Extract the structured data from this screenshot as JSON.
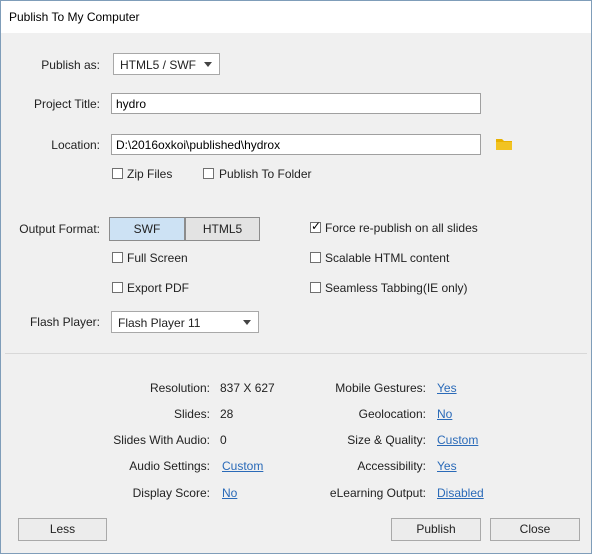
{
  "window": {
    "title": "Publish To My Computer"
  },
  "publish_as": {
    "label": "Publish as:",
    "value": "HTML5 / SWF"
  },
  "project_title": {
    "label": "Project Title:",
    "value": "hydro"
  },
  "location": {
    "label": "Location:",
    "value": "D:\\2016oxkoi\\published\\hydrox",
    "icon": "folder-icon",
    "icon_color": "#e8b100"
  },
  "zip_files": {
    "label": "Zip Files",
    "checked": false
  },
  "publish_to_folder": {
    "label": "Publish To Folder",
    "checked": false
  },
  "output_format": {
    "label": "Output Format:",
    "options": [
      "SWF",
      "HTML5"
    ],
    "selected": "SWF"
  },
  "force_republish": {
    "label": "Force re-publish on all slides",
    "checked": true
  },
  "full_screen": {
    "label": "Full Screen",
    "checked": false
  },
  "scalable_html": {
    "label": "Scalable HTML content",
    "checked": false
  },
  "export_pdf": {
    "label": "Export PDF",
    "checked": false
  },
  "seamless_tabbing": {
    "label": "Seamless Tabbing(IE only)",
    "checked": false
  },
  "flash_player": {
    "label": "Flash Player:",
    "value": "Flash Player 11"
  },
  "info": {
    "resolution": {
      "label": "Resolution:",
      "value": "837 X 627"
    },
    "slides": {
      "label": "Slides:",
      "value": "28"
    },
    "slides_with_audio": {
      "label": "Slides With Audio:",
      "value": "0"
    },
    "audio_settings": {
      "label": "Audio Settings:",
      "value": "Custom"
    },
    "display_score": {
      "label": "Display Score:",
      "value": "No"
    },
    "mobile_gestures": {
      "label": "Mobile Gestures:",
      "value": "Yes"
    },
    "geolocation": {
      "label": "Geolocation:",
      "value": "No"
    },
    "size_quality": {
      "label": "Size & Quality:",
      "value": "Custom"
    },
    "accessibility": {
      "label": "Accessibility:",
      "value": "Yes"
    },
    "elearning_output": {
      "label": "eLearning Output:",
      "value": "Disabled"
    }
  },
  "buttons": {
    "less": "Less",
    "publish": "Publish",
    "close": "Close"
  },
  "colors": {
    "link": "#2a6ab8",
    "selected_segment": "#cde2f4"
  }
}
